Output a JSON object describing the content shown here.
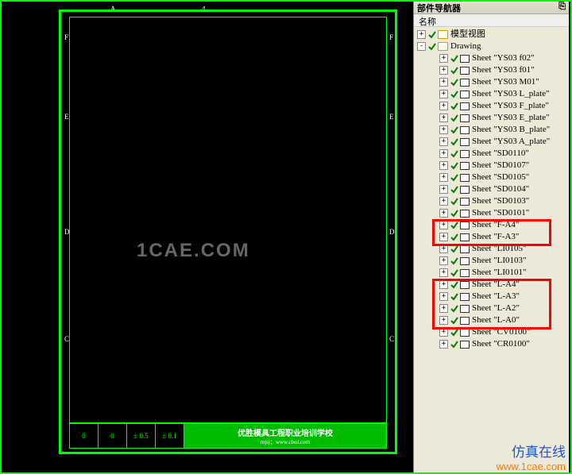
{
  "panel": {
    "title": "部件导航器",
    "pin": "⎘",
    "header": "名称",
    "root": "模型视图",
    "drawing": "Drawing",
    "items": [
      {
        "label": "Sheet \"YS03 f02\"",
        "box": 0
      },
      {
        "label": "Sheet \"YS03 f01\"",
        "box": 0
      },
      {
        "label": "Sheet \"YS03 M01\"",
        "box": 0
      },
      {
        "label": "Sheet \"YS03 L_plate\"",
        "box": 0
      },
      {
        "label": "Sheet \"YS03 F_plate\"",
        "box": 0
      },
      {
        "label": "Sheet \"YS03 E_plate\"",
        "box": 0
      },
      {
        "label": "Sheet \"YS03 B_plate\"",
        "box": 0
      },
      {
        "label": "Sheet \"YS03 A_plate\"",
        "box": 0
      },
      {
        "label": "Sheet \"SD0110\"",
        "box": 0
      },
      {
        "label": "Sheet \"SD0107\"",
        "box": 0
      },
      {
        "label": "Sheet \"SD0105\"",
        "box": 0
      },
      {
        "label": "Sheet \"SD0104\"",
        "box": 0
      },
      {
        "label": "Sheet \"SD0103\"",
        "box": 0
      },
      {
        "label": "Sheet \"SD0101\"",
        "box": 0
      },
      {
        "label": "Sheet \"F-A4\"",
        "box": 1
      },
      {
        "label": "Sheet \"F-A3\"",
        "box": 1
      },
      {
        "label": "Sheet \"LI0105\"",
        "box": 0
      },
      {
        "label": "Sheet \"LI0103\"",
        "box": 0
      },
      {
        "label": "Sheet \"LI0101\"",
        "box": 0
      },
      {
        "label": "Sheet \"L-A4\"",
        "box": 2
      },
      {
        "label": "Sheet \"L-A3\"",
        "box": 2
      },
      {
        "label": "Sheet \"L-A2\"",
        "box": 2
      },
      {
        "label": "Sheet \"L-A0\"",
        "box": 2
      },
      {
        "label": "Sheet \"CV0100\"",
        "box": 0
      },
      {
        "label": "Sheet \"CR0100\"",
        "box": 0
      }
    ]
  },
  "drawing": {
    "top_marks": [
      "A",
      "4"
    ],
    "side_marks": [
      "F",
      "E",
      "D",
      "C"
    ],
    "title_school": "优胜模具工程职业培训学校",
    "title_sub": "mjsj；www.cbsd.com",
    "cells": [
      "0",
      "0",
      "± 0.5",
      "± 0.1"
    ]
  },
  "watermark": "1CAE.COM",
  "footer": {
    "cn": "仿真在线",
    "url": "www.1cae.com"
  }
}
